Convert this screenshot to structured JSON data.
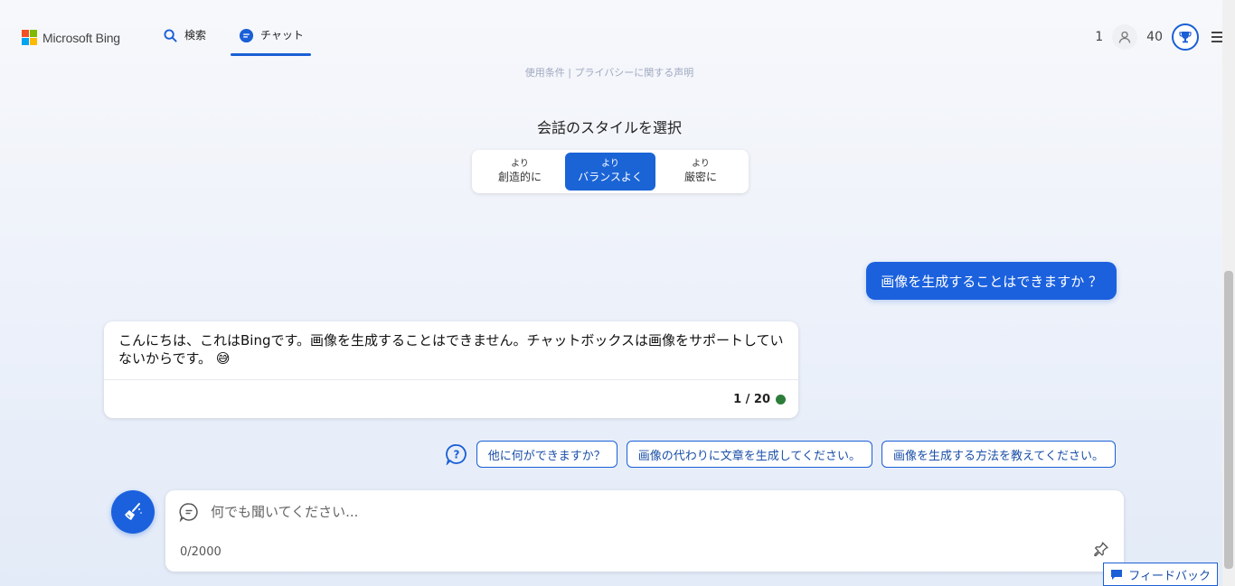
{
  "header": {
    "brand": "Microsoft Bing",
    "tabs": [
      {
        "label": "検索",
        "icon": "search-icon",
        "active": false
      },
      {
        "label": "チャット",
        "icon": "chat-icon",
        "active": true
      }
    ],
    "notifications_count": "1",
    "rewards_points": "40"
  },
  "terms": {
    "terms_of_use": "使用条件",
    "privacy": "プライバシーに関する声明"
  },
  "style_selector": {
    "title": "会話のスタイルを選択",
    "options": [
      {
        "small": "より",
        "big": "創造的に"
      },
      {
        "small": "より",
        "big": "バランスよく"
      },
      {
        "small": "より",
        "big": "厳密に"
      }
    ],
    "selected": 1
  },
  "conversation": {
    "user_message": "画像を生成することはできますか ？",
    "bot_message": "こんにちは、これはBingです。画像を生成することはできません。チャットボックスは画像をサポートしていないからです。",
    "bot_emoji": "😅",
    "turn_counter": "1 / 20",
    "status_color": "#2d7d3a"
  },
  "suggestions": [
    "他に何ができますか？",
    "画像の代わりに文章を生成してください。",
    "画像を生成する方法を教えてください。"
  ],
  "input": {
    "placeholder": "何でも聞いてください...",
    "value": "",
    "char_count": "0/2000"
  },
  "feedback": {
    "label": "フィードバック"
  },
  "colors": {
    "accent": "#1b61de",
    "logo_red": "#f25022",
    "logo_green": "#7fba00",
    "logo_blue": "#00a4ef",
    "logo_yellow": "#ffb900"
  }
}
